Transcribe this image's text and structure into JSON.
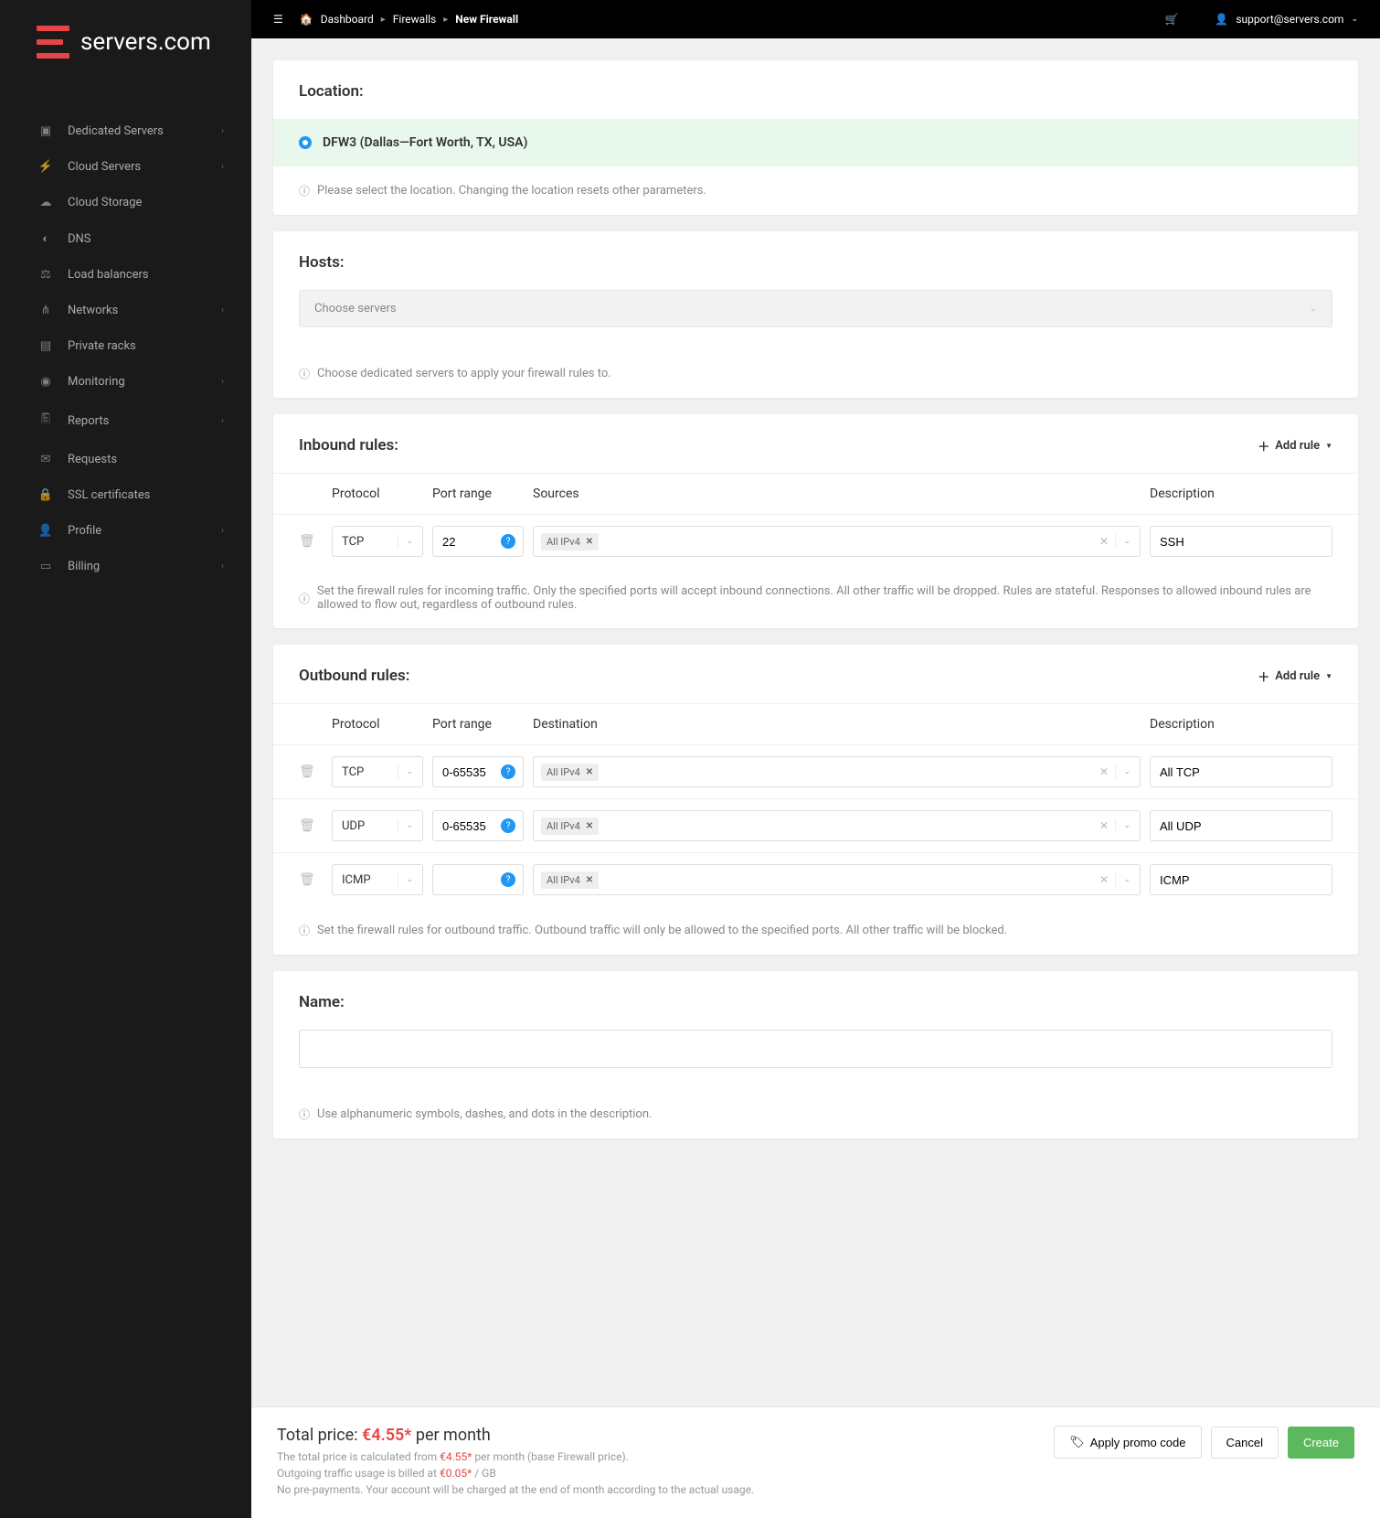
{
  "brand": "servers.com",
  "nav": [
    {
      "icon": "▣",
      "label": "Dedicated Servers",
      "expand": true
    },
    {
      "icon": "⚡",
      "label": "Cloud Servers",
      "expand": true
    },
    {
      "icon": "☁",
      "label": "Cloud Storage",
      "expand": false
    },
    {
      "icon": "◐",
      "label": "DNS",
      "expand": false
    },
    {
      "icon": "⚖",
      "label": "Load balancers",
      "expand": false
    },
    {
      "icon": "⋔",
      "label": "Networks",
      "expand": true
    },
    {
      "icon": "▤",
      "label": "Private racks",
      "expand": false
    },
    {
      "icon": "◉",
      "label": "Monitoring",
      "expand": true
    },
    {
      "icon": "🖺",
      "label": "Reports",
      "expand": true
    },
    {
      "icon": "✉",
      "label": "Requests",
      "expand": false
    },
    {
      "icon": "🔒",
      "label": "SSL certificates",
      "expand": false
    },
    {
      "icon": "👤",
      "label": "Profile",
      "expand": true
    },
    {
      "icon": "▭",
      "label": "Billing",
      "expand": true
    }
  ],
  "breadcrumb": {
    "home": "Dashboard",
    "mid": "Firewalls",
    "cur": "New Firewall"
  },
  "user": "support@servers.com",
  "location": {
    "title": "Location:",
    "selected": "DFW3 (Dallas—Fort Worth, TX, USA)",
    "note": "Please select the location. Changing the location resets other parameters."
  },
  "hosts": {
    "title": "Hosts:",
    "placeholder": "Choose servers",
    "note": "Choose dedicated servers to apply your firewall rules to."
  },
  "inbound": {
    "title": "Inbound rules:",
    "add": "Add rule",
    "cols": {
      "proto": "Protocol",
      "port": "Port range",
      "src": "Sources",
      "desc": "Description"
    },
    "rows": [
      {
        "proto": "TCP",
        "port": "22",
        "tag": "All IPv4",
        "desc": "SSH"
      }
    ],
    "note": "Set the firewall rules for incoming traffic. Only the specified ports will accept inbound connections. All other traffic will be dropped. Rules are stateful. Responses to allowed inbound rules are allowed to flow out, regardless of outbound rules."
  },
  "outbound": {
    "title": "Outbound rules:",
    "add": "Add rule",
    "cols": {
      "proto": "Protocol",
      "port": "Port range",
      "src": "Destination",
      "desc": "Description"
    },
    "rows": [
      {
        "proto": "TCP",
        "port": "0-65535",
        "tag": "All IPv4",
        "desc": "All TCP"
      },
      {
        "proto": "UDP",
        "port": "0-65535",
        "tag": "All IPv4",
        "desc": "All UDP"
      },
      {
        "proto": "ICMP",
        "port": "",
        "tag": "All IPv4",
        "desc": "ICMP"
      }
    ],
    "note": "Set the firewall rules for outbound traffic. Outbound traffic will only be allowed to the specified ports. All other traffic will be blocked."
  },
  "name": {
    "title": "Name:",
    "note": "Use alphanumeric symbols, dashes, and dots in the description."
  },
  "footer": {
    "total_label": "Total price: ",
    "total_amount": "€4.55*",
    "total_suffix": " per month",
    "line1_a": "The total price is calculated from ",
    "line1_b": "€4.55*",
    "line1_c": " per month (base Firewall price).",
    "line2_a": "Outgoing traffic usage is billed at ",
    "line2_b": "€0.05*",
    "line2_c": " / GB",
    "line3": "No pre-payments. Your account will be charged at the end of month according to the actual usage.",
    "promo": "Apply promo code",
    "cancel": "Cancel",
    "create": "Create"
  }
}
